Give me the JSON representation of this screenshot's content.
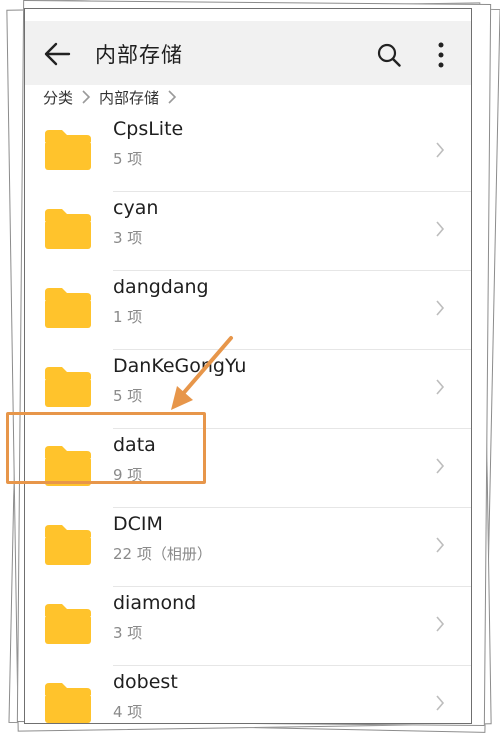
{
  "header": {
    "title": "内部存储"
  },
  "breadcrumb": {
    "root": "分类",
    "current": "内部存储"
  },
  "folders": [
    {
      "name": "CpsLite",
      "info": "5 项"
    },
    {
      "name": "cyan",
      "info": "3 项"
    },
    {
      "name": "dangdang",
      "info": "1 项"
    },
    {
      "name": "DanKeGongYu",
      "info": "5 项"
    },
    {
      "name": "data",
      "info": "9 项"
    },
    {
      "name": "DCIM",
      "info": "22 项（相册）"
    },
    {
      "name": "diamond",
      "info": "3 项"
    },
    {
      "name": "dobest",
      "info": "4 项"
    }
  ],
  "colors": {
    "folder": "#ffc32c",
    "highlight": "#e7964a",
    "appbar": "#f1f1f1"
  },
  "icons": {
    "back": "arrow-left-icon",
    "search": "search-icon",
    "more": "more-vertical-icon",
    "folder": "folder-icon",
    "chevron": "chevron-right-icon"
  }
}
